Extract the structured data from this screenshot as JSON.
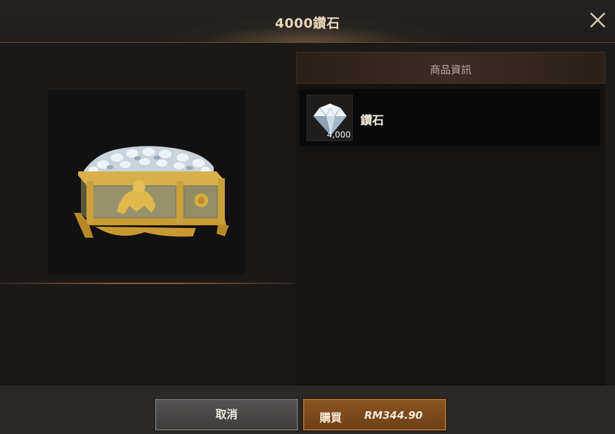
{
  "header": {
    "title": "4000鑽石"
  },
  "info": {
    "header_label": "商品資訊",
    "items": [
      {
        "name": "鑽石",
        "quantity": "4,000",
        "icon": "diamond-icon"
      }
    ]
  },
  "product": {
    "image": "diamond-treasure-chest"
  },
  "footer": {
    "cancel_label": "取消",
    "buy_label": "購買",
    "price": "RM344.90"
  },
  "colors": {
    "buy_button": "#7a461a",
    "cancel_button": "#4a4847",
    "accent_line": "#8a5a34"
  }
}
